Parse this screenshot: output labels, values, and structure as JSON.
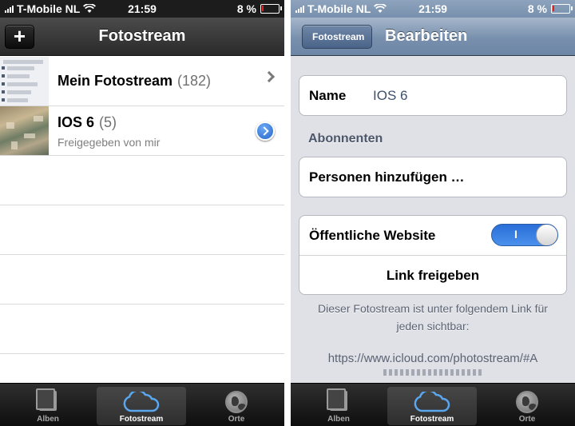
{
  "status_bar": {
    "carrier": "T-Mobile NL",
    "time": "21:59",
    "battery": "8 %"
  },
  "left": {
    "nav_title": "Fotostream",
    "add_button": "+",
    "rows": [
      {
        "title": "Mein Fotostream",
        "count": "(182)",
        "subtitle": ""
      },
      {
        "title": "IOS 6",
        "count": "(5)",
        "subtitle": "Freigegeben von mir"
      }
    ]
  },
  "right": {
    "back_button": "Fotostream",
    "nav_title": "Bearbeiten",
    "name_label": "Name",
    "name_value": "IOS 6",
    "section_header": "Abonnenten",
    "add_people": "Personen hinzufügen …",
    "public_website_label": "Öffentliche Website",
    "toggle_on_label": "I",
    "share_link": "Link freigeben",
    "footer_text": "Dieser Fotostream ist unter folgendem Link für jeden sichtbar:",
    "url": "https://www.icloud.com/photostream/#A"
  },
  "tabbar": {
    "tabs": [
      {
        "label": "Alben",
        "icon": "album-icon",
        "active": false
      },
      {
        "label": "Fotostream",
        "icon": "cloud-icon",
        "active": true
      },
      {
        "label": "Orte",
        "icon": "globe-icon",
        "active": false
      }
    ]
  },
  "colors": {
    "accent_blue": "#2f76dd",
    "nav_blue": "#7890ad",
    "nav_dark": "#2a2a2a",
    "grouped_bg": "#dfe1e7"
  }
}
